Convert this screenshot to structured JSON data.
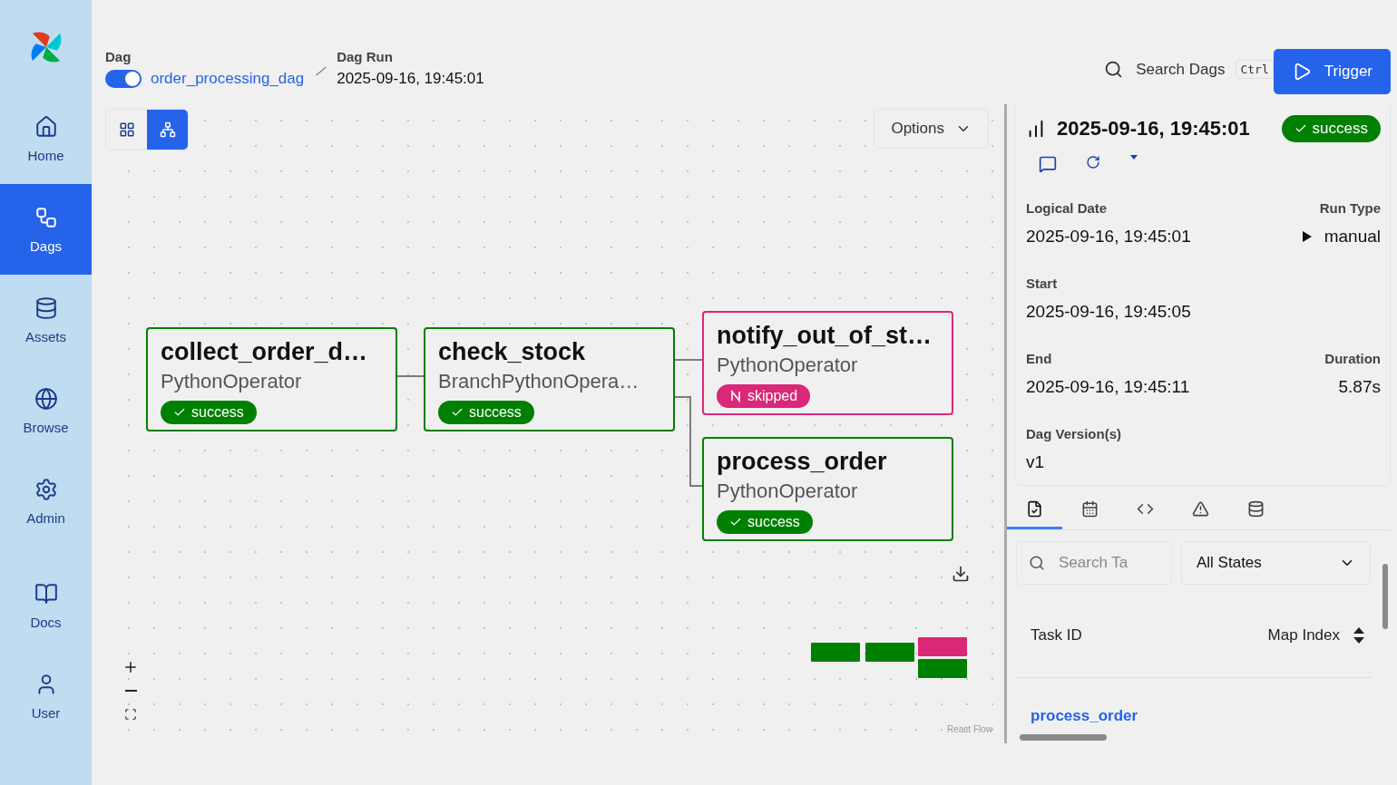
{
  "sidebar": {
    "items": [
      {
        "label": "Home",
        "selected": false
      },
      {
        "label": "Dags",
        "selected": true
      },
      {
        "label": "Assets",
        "selected": false
      },
      {
        "label": "Browse",
        "selected": false
      },
      {
        "label": "Admin",
        "selected": false
      }
    ],
    "footer_items": [
      {
        "label": "Docs",
        "selected": false
      },
      {
        "label": "User",
        "selected": false
      }
    ]
  },
  "breadcrumb": {
    "dag": {
      "label": "Dag",
      "enabled": true,
      "name": "order_processing_dag"
    },
    "run": {
      "label": "Dag Run",
      "value": "2025-09-16, 19:45:01"
    }
  },
  "header": {
    "search": "Search Dags",
    "shortcut": "Ctrl",
    "trigger": "Trigger"
  },
  "graph": {
    "views": [
      {
        "selected": false
      },
      {
        "selected": true
      }
    ],
    "options": "Options",
    "nodes": [
      {
        "name": "collect_order_d…",
        "operator": "PythonOperator",
        "kind": "success",
        "badge": "success"
      },
      {
        "name": "check_stock",
        "operator": "BranchPythonOpera…",
        "kind": "success",
        "badge": "success"
      },
      {
        "name": "notify_out_of_st…",
        "operator": "PythonOperator",
        "kind": "skipped",
        "badge": "skipped"
      },
      {
        "name": "process_order",
        "operator": "PythonOperator",
        "kind": "success",
        "badge": "success"
      }
    ],
    "attribution": "React Flow"
  },
  "details": {
    "title": "2025-09-16, 19:45:01",
    "kind": "success",
    "badge": "success",
    "fields": [
      {
        "label": "Logical Date",
        "value": "2025-09-16, 19:45:01"
      },
      {
        "label": "Run Type",
        "value": "manual"
      },
      {
        "label": "Start",
        "value": "2025-09-16, 19:45:05"
      },
      {
        "label": "End",
        "value": "2025-09-16, 19:45:11"
      },
      {
        "label": "Duration",
        "value": "5.87s"
      },
      {
        "label": "Dag Version(s)",
        "value": "v1"
      }
    ],
    "tabs": [
      {
        "selected": true
      },
      {
        "selected": false
      },
      {
        "selected": false
      },
      {
        "selected": false
      },
      {
        "selected": false
      }
    ],
    "filter": {
      "placeholder": "Search Ta",
      "state": "All States"
    },
    "table": {
      "columns": [
        "Task ID",
        "Map Index"
      ],
      "rows": [
        {
          "task_id": "process_order"
        }
      ]
    }
  }
}
